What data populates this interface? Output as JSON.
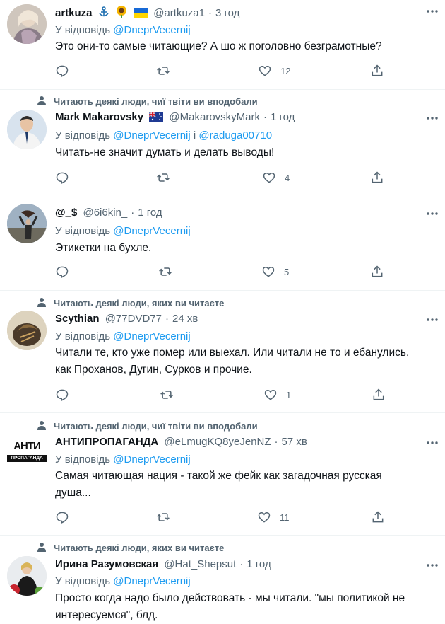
{
  "tweets": [
    {
      "social": "",
      "name": "artkuza",
      "handle": "@artkuza1",
      "time": "3 год",
      "reply_prefix": "У відповідь",
      "reply_mentions": "@DneprVecernij",
      "reply_join": "",
      "reply_mention2": "",
      "lines": [
        "Это они-то самые читающие? А шо ж поголовно безграмотные?"
      ],
      "likes": "12",
      "flags": [
        "anchor",
        "sunflower",
        "ukraine"
      ]
    },
    {
      "social": "Читають деякі люди, чиї твіти ви вподобали",
      "name": "Mark Makarovsky",
      "handle": "@MakarovskyMark",
      "time": "1 год",
      "reply_prefix": "У відповідь",
      "reply_mentions": "@DneprVecernij",
      "reply_join": "і",
      "reply_mention2": "@raduga00710",
      "lines": [
        "Читать-не значит думать и делать выводы!"
      ],
      "likes": "4",
      "flags": [
        "australia"
      ]
    },
    {
      "social": "",
      "name": "@_$",
      "handle": "@6i6kin_",
      "time": "1 год",
      "reply_prefix": "У відповідь",
      "reply_mentions": "@DneprVecernij",
      "reply_join": "",
      "reply_mention2": "",
      "lines": [
        "Этикетки на бухле."
      ],
      "likes": "5",
      "flags": []
    },
    {
      "social": "Читають деякі люди, яких ви читаєте",
      "name": "Scythian",
      "handle": "@77DVD77",
      "time": "24 хв",
      "reply_prefix": "У відповідь",
      "reply_mentions": "@DneprVecernij",
      "reply_join": "",
      "reply_mention2": "",
      "lines": [
        "Читали те, кто уже помер или выехал. Или читали не то и ебанулись,",
        "как Проханов, Дугин, Сурков и прочие."
      ],
      "likes": "1",
      "flags": []
    },
    {
      "social": "Читають деякі люди, чиї твіти ви вподобали",
      "name": "АНТИПРОПАГАНДА",
      "handle": "@eLmugKQ8yeJenNZ",
      "time": "57 хв",
      "reply_prefix": "У відповідь",
      "reply_mentions": "@DneprVecernij",
      "reply_join": "",
      "reply_mention2": "",
      "lines": [
        "Самая читающая нация - такой же фейк как загадочная русская",
        "душа..."
      ],
      "likes": "11",
      "flags": [],
      "avatar_logo_top": "АНТИ",
      "avatar_logo_bottom": "ПРОПАГАНДА"
    },
    {
      "social": "Читають деякі люди, яких ви читаєте",
      "name": "Ирина Разумовская",
      "handle": "@Hat_Shepsut",
      "time": "1 год",
      "reply_prefix": "У відповідь",
      "reply_mentions": "@DneprVecernij",
      "reply_join": "",
      "reply_mention2": "",
      "lines": [
        "Просто когда надо было действовать - мы читали. \"мы политикой не",
        "интересуемся\", блд."
      ],
      "likes": "",
      "flags": []
    }
  ],
  "colors": {
    "mention": "#1d9bf0",
    "secondary": "#536471",
    "text": "#0f1419"
  }
}
